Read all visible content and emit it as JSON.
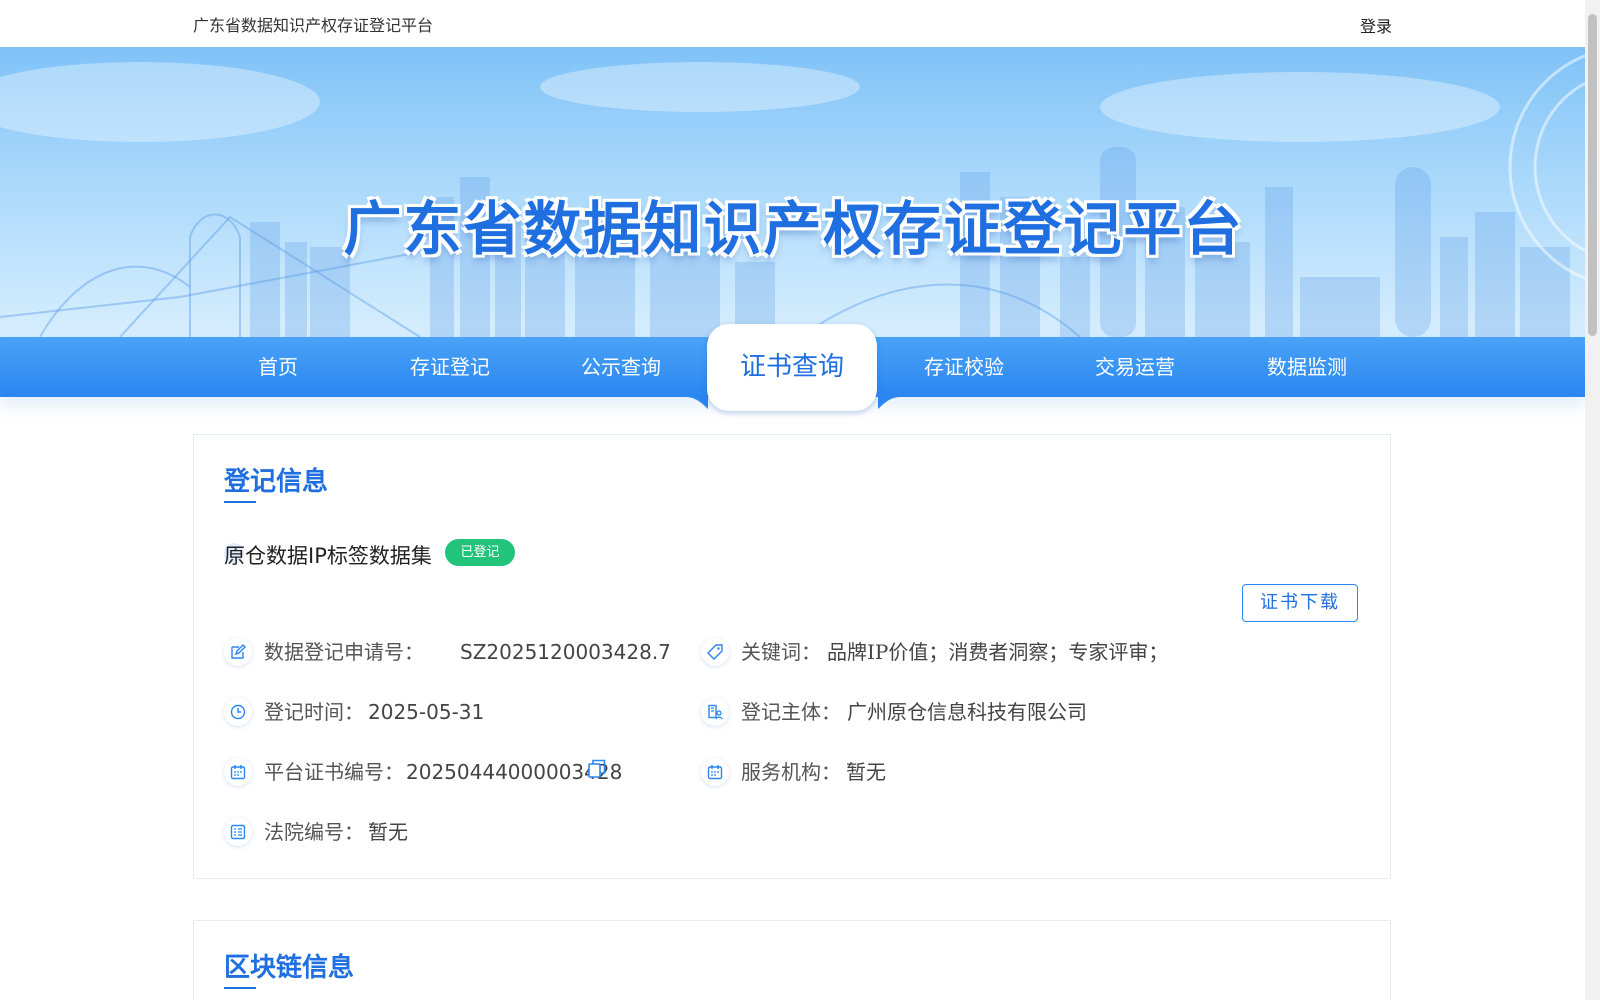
{
  "topbar": {
    "site_name": "广东省数据知识产权存证登记平台",
    "login": "登录"
  },
  "banner": {
    "title": "广东省数据知识产权存证登记平台"
  },
  "nav": {
    "items": [
      {
        "label": "首页"
      },
      {
        "label": "存证登记"
      },
      {
        "label": "公示查询"
      },
      {
        "label": "证书查询",
        "active": true
      },
      {
        "label": "存证校验"
      },
      {
        "label": "交易运营"
      },
      {
        "label": "数据监测"
      }
    ]
  },
  "registration": {
    "title": "登记信息",
    "dataset_name": "原仓数据IP标签数据集",
    "status": "已登记",
    "download_label": "证书下载",
    "fields": {
      "application_no": {
        "label": "数据登记申请号：",
        "value": "SZ2025120003428.7"
      },
      "keywords": {
        "label": "关键词：",
        "value": "品牌IP价值；消费者洞察；专家评审；"
      },
      "reg_time": {
        "label": "登记时间：",
        "value": "2025-05-31"
      },
      "subject": {
        "label": "登记主体：",
        "value": "广州原仓信息科技有限公司"
      },
      "cert_no": {
        "label": "平台证书编号：",
        "value": "20250444000003428"
      },
      "service_org": {
        "label": "服务机构：",
        "value": "暂无"
      },
      "court_no": {
        "label": "法院编号：",
        "value": "暂无"
      }
    }
  },
  "blockchain": {
    "title": "区块链信息"
  },
  "colors": {
    "primary": "#1f6fe0",
    "nav": "#2a86f0",
    "badge": "#22c37a"
  }
}
